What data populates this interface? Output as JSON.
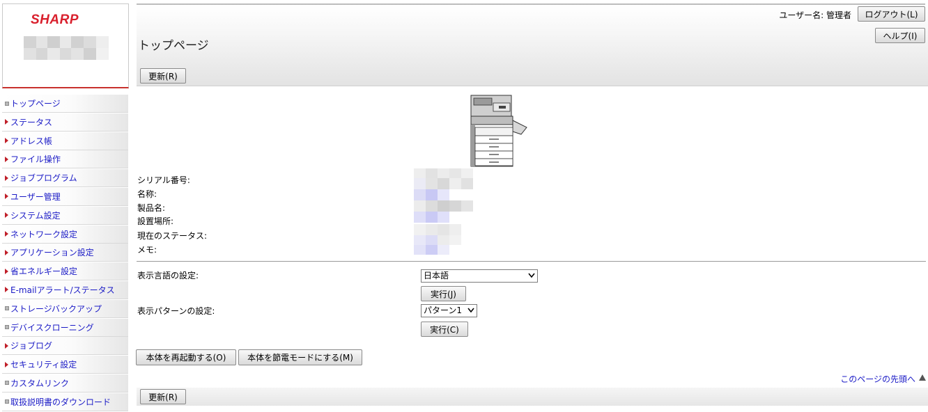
{
  "brand": {
    "logo_text": "SHARP"
  },
  "sidebar": {
    "items": [
      {
        "label": "トップページ",
        "icon": "square-bullet-icon"
      },
      {
        "label": "ステータス",
        "icon": "triangle-bullet-icon"
      },
      {
        "label": "アドレス帳",
        "icon": "triangle-bullet-icon"
      },
      {
        "label": "ファイル操作",
        "icon": "triangle-bullet-icon"
      },
      {
        "label": "ジョブプログラム",
        "icon": "triangle-bullet-icon"
      },
      {
        "label": "ユーザー管理",
        "icon": "triangle-bullet-icon"
      },
      {
        "label": "システム設定",
        "icon": "triangle-bullet-icon"
      },
      {
        "label": "ネットワーク設定",
        "icon": "triangle-bullet-icon"
      },
      {
        "label": "アプリケーション設定",
        "icon": "triangle-bullet-icon"
      },
      {
        "label": "省エネルギー設定",
        "icon": "triangle-bullet-icon"
      },
      {
        "label": "E-mailアラート/ステータス",
        "icon": "triangle-bullet-icon"
      },
      {
        "label": "ストレージバックアップ",
        "icon": "square-bullet-icon"
      },
      {
        "label": "デバイスクローニング",
        "icon": "square-bullet-icon"
      },
      {
        "label": "ジョブログ",
        "icon": "triangle-bullet-icon"
      },
      {
        "label": "セキュリティ設定",
        "icon": "triangle-bullet-icon"
      },
      {
        "label": "カスタムリンク",
        "icon": "square-bullet-icon"
      },
      {
        "label": "取扱説明書のダウンロード",
        "icon": "square-bullet-icon"
      }
    ]
  },
  "header": {
    "title": "トップページ",
    "user_label": "ユーザー名: 管理者",
    "logout_label": "ログアウト(L)",
    "help_label": "ヘルプ(I)",
    "refresh_label": "更新(R)"
  },
  "device_info": {
    "labels": [
      "シリアル番号:",
      "名称:",
      "製品名:",
      "設置場所:",
      "現在のステータス:",
      "メモ:"
    ]
  },
  "settings": {
    "language_label": "表示言語の設定:",
    "language_value": "日本語",
    "language_apply": "実行(J)",
    "pattern_label": "表示パターンの設定:",
    "pattern_value": "パターン1",
    "pattern_apply": "実行(C)"
  },
  "actions": {
    "restart_label": "本体を再起動する(O)",
    "sleep_label": "本体を節電モードにする(M)"
  },
  "footer": {
    "top_link": "このページの先頭へ",
    "refresh_label": "更新(R)"
  },
  "colors": {
    "link": "#1a1ac6",
    "brand_red": "#d9202d",
    "accent_red": "#c0202a"
  }
}
